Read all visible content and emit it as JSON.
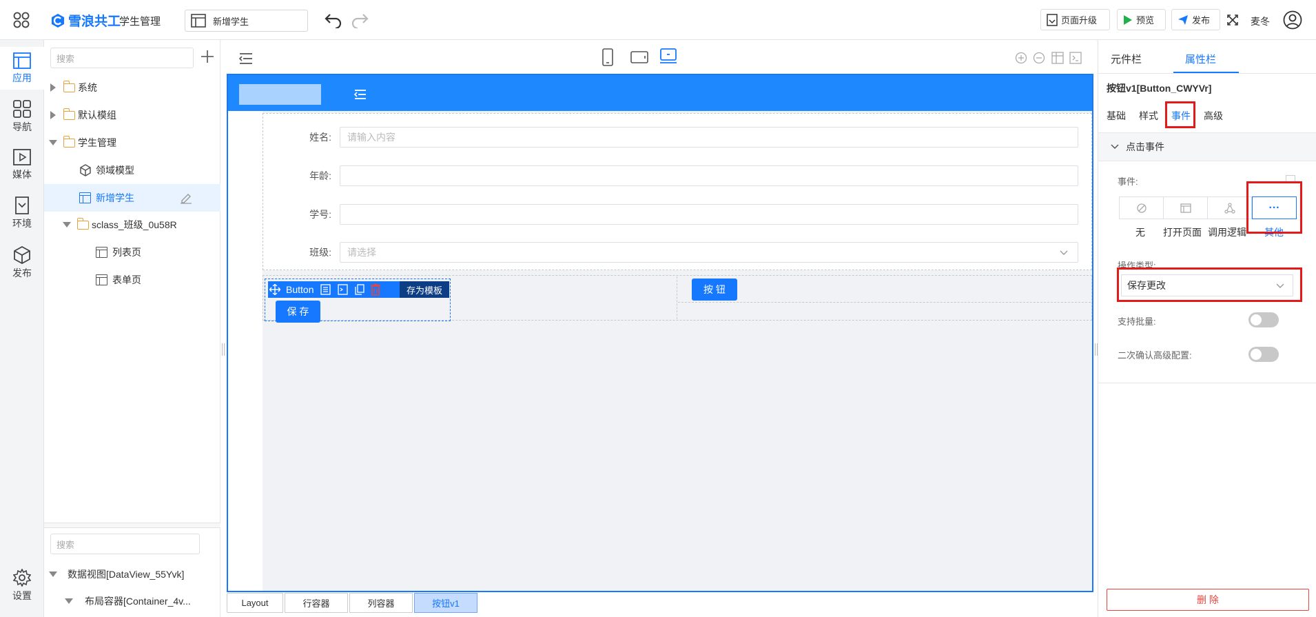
{
  "brand": {
    "name": "雪浪共工",
    "app_title": "学生管理"
  },
  "header": {
    "page_selector": "新增学生",
    "upgrade_label": "页面升级",
    "preview_label": "预览",
    "publish_label": "发布",
    "user_name": "麦冬"
  },
  "rail": [
    {
      "label": "应用",
      "icon": "app-icon"
    },
    {
      "label": "导航",
      "icon": "grid-icon"
    },
    {
      "label": "媒体",
      "icon": "media-icon"
    },
    {
      "label": "环境",
      "icon": "env-icon"
    },
    {
      "label": "发布",
      "icon": "cube-icon"
    },
    {
      "label": "设置",
      "icon": "gear-icon"
    }
  ],
  "tree": {
    "search_placeholder": "搜索",
    "items": [
      {
        "label": "系统"
      },
      {
        "label": "默认模组"
      },
      {
        "label": "学生管理"
      },
      {
        "label": "领域模型"
      },
      {
        "label": "新增学生"
      },
      {
        "label": "sclass_班级_0u58R"
      },
      {
        "label": "列表页"
      },
      {
        "label": "表单页"
      }
    ]
  },
  "outline": {
    "search_placeholder": "搜索",
    "items": [
      {
        "label": "数据视图[DataView_55Yvk]"
      },
      {
        "label": "布局容器[Container_4v..."
      }
    ]
  },
  "form": {
    "fields": [
      {
        "label": "姓名:",
        "placeholder": "请输入内容"
      },
      {
        "label": "年龄:",
        "placeholder": ""
      },
      {
        "label": "学号:",
        "placeholder": ""
      },
      {
        "label": "班级:",
        "placeholder": "请选择"
      }
    ],
    "toolbar_label": "Button",
    "save_template_label": "存为模板",
    "save_button": "保 存",
    "other_button": "按 钮"
  },
  "breadcrumb": [
    "Layout",
    "行容器",
    "列容器",
    "按钮v1"
  ],
  "panel": {
    "tabs": [
      "元件栏",
      "属性栏"
    ],
    "component_title": "按钮v1[Button_CWYVr]",
    "sub_tabs": [
      "基础",
      "样式",
      "事件",
      "高级"
    ],
    "section_title": "点击事件",
    "event_label": "事件:",
    "event_options": [
      "无",
      "打开页面",
      "调用逻辑",
      "其他"
    ],
    "op_type_label": "操作类型:",
    "op_type_value": "保存更改",
    "batch_label": "支持批量:",
    "confirm_label": "二次确认高级配置:",
    "delete_label": "删 除",
    "more_glyph": "···"
  },
  "colors": {
    "accent": "#1677ff",
    "header_blue": "#1e88ff",
    "highlight": "#e21a1a",
    "danger": "#e8453c"
  }
}
